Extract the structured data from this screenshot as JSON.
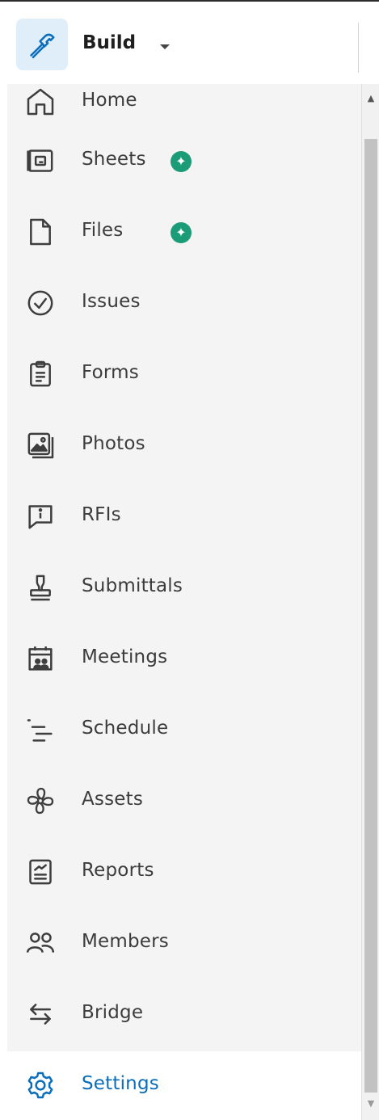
{
  "header": {
    "product_name": "Build",
    "app_icon": "hammer-icon",
    "dropdown_icon": "caret-down-icon"
  },
  "nav": {
    "items": [
      {
        "label": "Home",
        "icon": "home-icon"
      },
      {
        "label": "Sheets",
        "icon": "sheets-icon",
        "badge": "star-badge"
      },
      {
        "label": "Files",
        "icon": "file-icon",
        "badge": "star-badge"
      },
      {
        "label": "Issues",
        "icon": "check-circle-icon"
      },
      {
        "label": "Forms",
        "icon": "clipboard-icon"
      },
      {
        "label": "Photos",
        "icon": "photos-icon"
      },
      {
        "label": "RFIs",
        "icon": "info-chat-icon"
      },
      {
        "label": "Submittals",
        "icon": "stamp-icon"
      },
      {
        "label": "Meetings",
        "icon": "calendar-people-icon"
      },
      {
        "label": "Schedule",
        "icon": "schedule-icon"
      },
      {
        "label": "Assets",
        "icon": "fan-icon"
      },
      {
        "label": "Reports",
        "icon": "report-icon"
      },
      {
        "label": "Members",
        "icon": "members-icon"
      },
      {
        "label": "Bridge",
        "icon": "bridge-arrows-icon"
      },
      {
        "label": "Settings",
        "icon": "gear-icon",
        "active": true
      }
    ]
  },
  "colors": {
    "accent": "#0b6ebb",
    "badge": "#1b9c76",
    "sidebar_bg": "#f4f4f4"
  }
}
